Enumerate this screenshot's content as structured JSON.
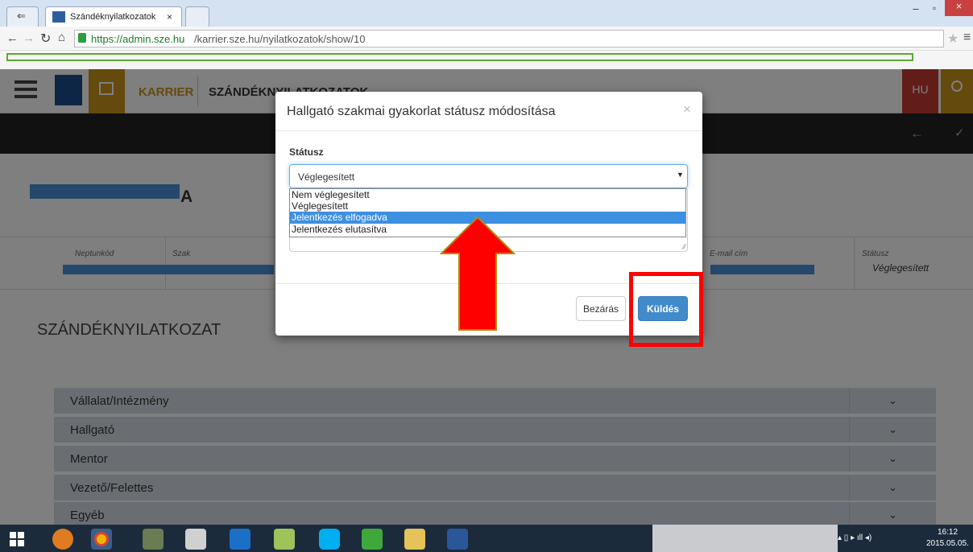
{
  "browser": {
    "tab_title": "Szándéknyilatkozatok",
    "tab_close": "×",
    "url_host": "https://admin.sze.hu",
    "url_path": "/karrier.sze.hu/nyilatkozatok/show/10"
  },
  "header": {
    "karrier": "KARRIER",
    "section": "SZÁNDÉKNYILATKOZATOK",
    "lang": "HU"
  },
  "page": {
    "name_suffix": "A",
    "section_title": "SZÁNDÉKNYILATKOZAT"
  },
  "info_table": {
    "neptun_label": "Neptunkód",
    "szak_label": "Szak",
    "email_label": "E-mail cím",
    "status_label": "Státusz",
    "status_value": "Véglegesített"
  },
  "accordion": [
    {
      "label": "Vállalat/Intézmény"
    },
    {
      "label": "Hallgató"
    },
    {
      "label": "Mentor"
    },
    {
      "label": "Vezető/Felettes"
    },
    {
      "label": "Egyéb"
    }
  ],
  "modal": {
    "title": "Hallgató szakmai gyakorlat státusz módosítása",
    "close": "×",
    "status_label": "Státusz",
    "selected": "Véglegesített",
    "options": [
      "Nem véglegesített",
      "Véglegesített",
      "Jelentkezés elfogadva",
      "Jelentkezés elutasítva"
    ],
    "close_button": "Bezárás",
    "send_button": "Küldés"
  },
  "taskbar": {
    "time": "16:12",
    "date": "2015.05.05."
  },
  "colors": {
    "accent_orange": "#c8941a",
    "brand_red": "#c53a32",
    "button_blue": "#428bca",
    "highlight_blue": "#3d8fe0",
    "annotation_red": "#ff0000"
  }
}
